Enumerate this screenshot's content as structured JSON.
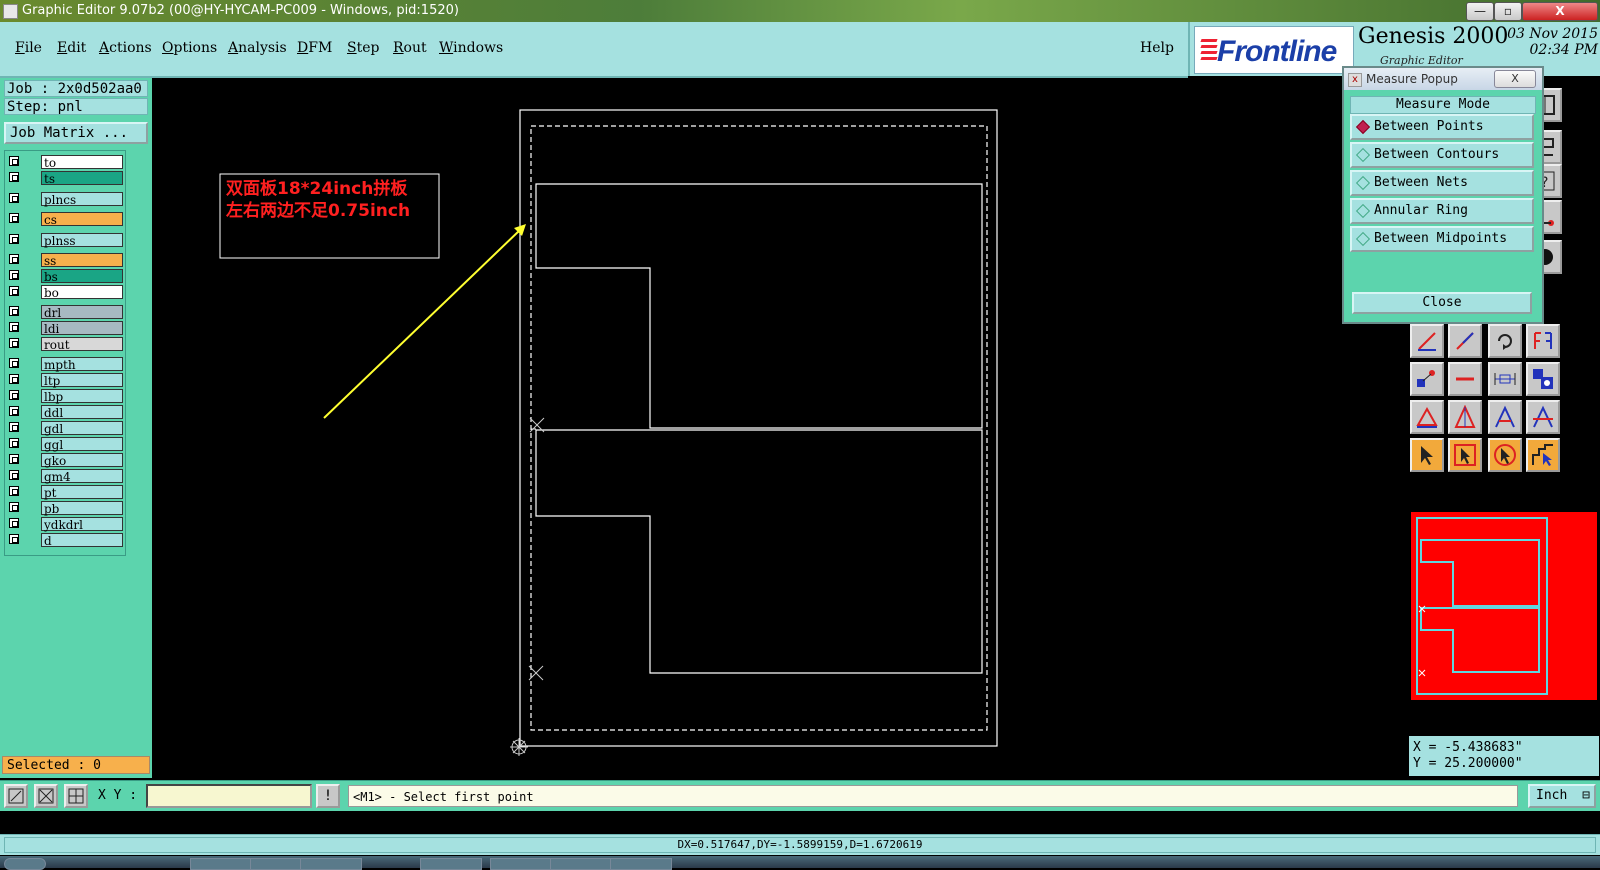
{
  "window": {
    "title": "Graphic Editor 9.07b2 (00@HY-HYCAM-PC009 - Windows, pid:1520)",
    "app_icon": "x-icon",
    "minimize": "—",
    "maximize": "▫",
    "close": "X"
  },
  "menu": {
    "items": [
      "File",
      "Edit",
      "Actions",
      "Options",
      "Analysis",
      "DFM",
      "Step",
      "Rout",
      "Windows"
    ],
    "help": "Help"
  },
  "brand": {
    "logo": "Frontline",
    "product": "Genesis 2000",
    "subtitle": "Graphic Editor",
    "date": "03 Nov 2015",
    "time": "02:34 PM"
  },
  "job": {
    "job_line": "Job : 2x0d502aa0",
    "step_line": "Step: pnl",
    "job_matrix": "Job Matrix ..."
  },
  "layers": [
    {
      "name": "to",
      "color": "#ffffff"
    },
    {
      "name": "ts",
      "color": "#1aa585"
    },
    {
      "name": "plncs",
      "color": "#a5e1e0"
    },
    {
      "name": "cs",
      "color": "#f7b04c"
    },
    {
      "name": "plnss",
      "color": "#a5e1e0"
    },
    {
      "name": "ss",
      "color": "#f7b04c"
    },
    {
      "name": "bs",
      "color": "#1aa585"
    },
    {
      "name": "bo",
      "color": "#ffffff"
    },
    {
      "name": "drl",
      "color": "#a7b9c2"
    },
    {
      "name": "ldi",
      "color": "#a7b9c2"
    },
    {
      "name": "rout",
      "color": "#d8d8d8"
    },
    {
      "name": "mpth",
      "color": "#a5e1e0"
    },
    {
      "name": "ltp",
      "color": "#a5e1e0"
    },
    {
      "name": "lbp",
      "color": "#a5e1e0"
    },
    {
      "name": "ddl",
      "color": "#a5e1e0"
    },
    {
      "name": "gdl",
      "color": "#a5e1e0"
    },
    {
      "name": "ggl",
      "color": "#a5e1e0"
    },
    {
      "name": "gko",
      "color": "#a5e1e0"
    },
    {
      "name": "gm4",
      "color": "#a5e1e0"
    },
    {
      "name": "pt",
      "color": "#a5e1e0"
    },
    {
      "name": "pb",
      "color": "#a5e1e0"
    },
    {
      "name": "ydkdrl",
      "color": "#a5e1e0"
    },
    {
      "name": "d",
      "color": "#a5e1e0"
    }
  ],
  "selected": "Selected : 0",
  "annotation": {
    "line1": "双面板18*24inch拼板",
    "line2": "左右两边不足0.75inch",
    "color": "#ff2020"
  },
  "measure_popup": {
    "title": "Measure Popup",
    "close_x": "X",
    "mode_label": "Measure Mode",
    "options": [
      {
        "label": "Between Points",
        "active": true
      },
      {
        "label": "Between Contours",
        "active": false
      },
      {
        "label": "Between Nets",
        "active": false
      },
      {
        "label": "Annular Ring",
        "active": false
      },
      {
        "label": "Between Midpoints",
        "active": false
      }
    ],
    "close_button": "Close"
  },
  "coords": {
    "x": "X = -5.438683\"",
    "y": "Y = 25.200000\""
  },
  "bottom": {
    "xy_label": "X Y :",
    "xy_value": "",
    "info_icon": "!",
    "prompt": "<M1> - Select first point",
    "unit": "Inch",
    "status": "DX=0.517647,DY=-1.5899159,D=1.6720619"
  },
  "colors": {
    "panel_teal": "#5cd4ad",
    "light_cyan": "#a5e1e0",
    "orange": "#f7b04c",
    "minimap_red": "#ff0000",
    "arrow_yellow": "#ffff30"
  }
}
